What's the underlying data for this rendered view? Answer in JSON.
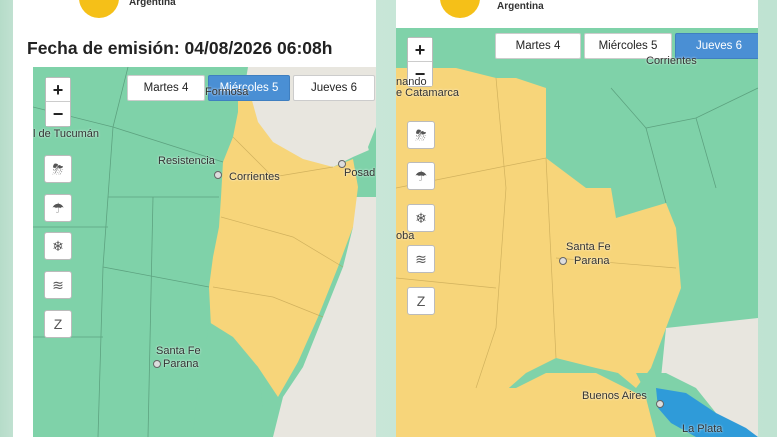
{
  "left": {
    "org_text": "Argentina",
    "emission": "Fecha de emisión: 04/08/2026 06:08h",
    "days": [
      {
        "label": "Martes 4",
        "active": false
      },
      {
        "label": "Miércoles 5",
        "active": true
      },
      {
        "label": "Jueves 6",
        "active": false
      }
    ],
    "labels": {
      "tucuman": "l de Tucumán",
      "formosa": "Formosa",
      "resistencia": "Resistencia",
      "corrientes": "Corrientes",
      "posadas": "Posad",
      "santafe": "Santa Fe",
      "parana": "Parana"
    }
  },
  "right": {
    "org_text": "Argentina",
    "days": [
      {
        "label": "Martes 4",
        "active": false
      },
      {
        "label": "Miércoles 5",
        "active": false
      },
      {
        "label": "Jueves 6",
        "active": true
      }
    ],
    "labels": {
      "corrientes": "Corrientes",
      "nando": "nando",
      "catamarca": "e Catamarca",
      "oba": "oba",
      "santafe": "Santa Fe",
      "parana": "Parana",
      "buenosaires": "Buenos Aires",
      "laplata": "La Plata"
    }
  },
  "zoom": {
    "in": "+",
    "out": "−"
  },
  "tools": [
    {
      "icon": "storm-icon",
      "glyph": "⛈"
    },
    {
      "icon": "rain-icon",
      "glyph": "☂"
    },
    {
      "icon": "snow-icon",
      "glyph": "❄"
    },
    {
      "icon": "wind-icon",
      "glyph": "≋"
    },
    {
      "icon": "zonda-icon",
      "glyph": "Z"
    }
  ],
  "colors": {
    "green": "#7fd2a9",
    "yellow": "#f7d57a",
    "blue": "#2f9bd9",
    "active_tab": "#4a8fd4",
    "sun": "#f5c018"
  }
}
